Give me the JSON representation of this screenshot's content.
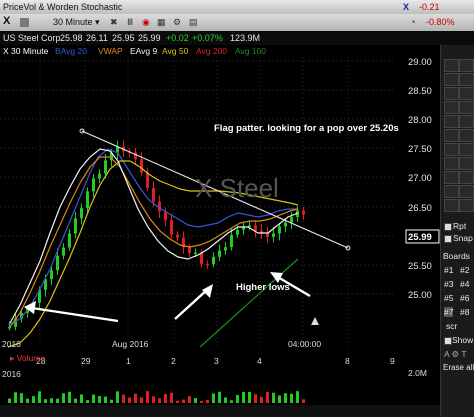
{
  "window": {
    "title": "PriceVol & Worden Stochastic",
    "change": "-0.21",
    "change_pct": "-0.80%"
  },
  "toolbar": {
    "timeframe": "30 Minute",
    "symbol": "X"
  },
  "quote": {
    "company": "US Steel Corp",
    "open": "25.98",
    "high": "26.11",
    "low": "25.95",
    "last": "25.99",
    "change": "+0.02",
    "change_pct": "+0.07%",
    "volume": "123.9M"
  },
  "indicators": {
    "symbol_tf": "X 30 Minute",
    "avg20": "BAvg 20",
    "vwap": "VWAP",
    "eavg9": "EAvg 9",
    "avg50": "Avg 50",
    "avg200": "Avg 200",
    "avg100": "Avg 100"
  },
  "annotations": {
    "flag_text": "Flag patter.  looking for a pop over 25.20s",
    "higher_lows": "Higher lows"
  },
  "price_axis": {
    "ticks": [
      "29.00",
      "28.50",
      "28.00",
      "27.50",
      "27.00",
      "26.50",
      "26.00",
      "25.50",
      "25.00"
    ],
    "last_price": "25.99"
  },
  "date_axis": {
    "labels": [
      "28",
      "29",
      "1",
      "2",
      "3",
      "4",
      "8",
      "9"
    ],
    "year_left": "2016",
    "month": "Aug 2016",
    "year_right": "2016",
    "time": "04:00:00"
  },
  "volume": {
    "label": "Volume",
    "scale_top": "2.0M"
  },
  "watermark": "X Steel",
  "right_panel": {
    "rpt": "Rpt",
    "snap": "Snap",
    "boards": "Boards",
    "items": [
      "#1",
      "#2",
      "#3",
      "#4",
      "#5",
      "#6",
      "#7",
      "#8"
    ],
    "scr": "scr",
    "show": "Show",
    "erase_all": "Erase all"
  },
  "colors": {
    "up": "#22cc22",
    "down": "#e02020",
    "trendline": "#e8e8e8",
    "ma_blue": "#3a56d8",
    "ma_yellow": "#d8c21a",
    "ma_orange": "#d98a1c",
    "ma_white": "#f2f2f2",
    "ma_green": "#1f8a1f"
  }
}
